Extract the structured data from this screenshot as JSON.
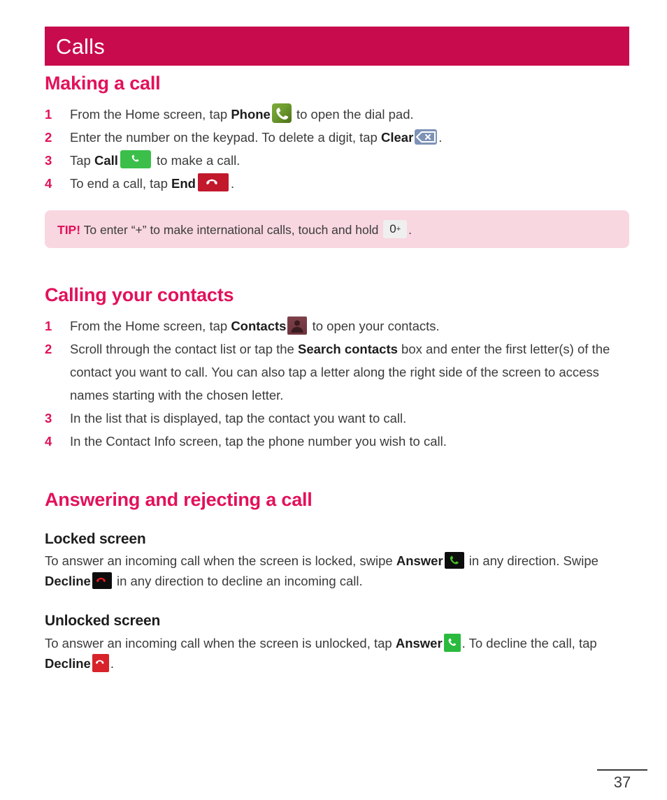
{
  "header": {
    "chapter_title": "Calls",
    "bar_color": "#c80b4c"
  },
  "colors": {
    "accent_pink": "#e2115a",
    "tip_background": "#f8d7e0",
    "body_text": "#3b3b3b"
  },
  "sections": [
    {
      "id": "making-a-call",
      "title": "Making a call",
      "steps": [
        {
          "num": "1",
          "pre": "From the Home screen, tap ",
          "bold": "Phone",
          "icon": "phone-home-icon",
          "post": " to open the dial pad."
        },
        {
          "num": "2",
          "pre": "Enter the number on the keypad. To delete a digit, tap ",
          "bold": "Clear",
          "icon": "clear-backspace-icon",
          "post": "."
        },
        {
          "num": "3",
          "pre": "Tap ",
          "bold": "Call",
          "icon": "call-button-icon",
          "post": " to make a call."
        },
        {
          "num": "4",
          "pre": "To end a call, tap ",
          "bold": "End",
          "icon": "end-call-icon",
          "post": "."
        }
      ],
      "tip": {
        "label": "TIP!",
        "pre": " To enter “+” to make international calls, touch and hold ",
        "key_digit": "0",
        "key_plus": "+",
        "post": "."
      }
    },
    {
      "id": "calling-your-contacts",
      "title": "Calling your contacts",
      "steps": [
        {
          "num": "1",
          "pre": "From the Home screen, tap ",
          "bold": "Contacts",
          "icon": "contacts-icon",
          "post": " to open your contacts."
        },
        {
          "num": "2",
          "pre": "Scroll through the contact list or tap the ",
          "bold": "Search contacts",
          "post": " box and enter the first letter(s) of the contact you want to call. You can also tap a letter along the right side of the screen to access names starting with the chosen letter."
        },
        {
          "num": "3",
          "pre": "In the list that is displayed, tap the contact you want to call."
        },
        {
          "num": "4",
          "pre": "In the Contact Info screen, tap the phone number you wish to call."
        }
      ]
    },
    {
      "id": "answering-and-rejecting",
      "title": "Answering and rejecting a call",
      "subsections": [
        {
          "id": "locked-screen",
          "title": "Locked screen",
          "pre": "To answer an incoming call when the screen is locked, swipe ",
          "bold1": "Answer",
          "icon1": "answer-locked-icon",
          "mid": " in any direction. Swipe ",
          "bold2": "Decline",
          "icon2": "decline-locked-icon",
          "post": " in any direction to decline an incoming call."
        },
        {
          "id": "unlocked-screen",
          "title": "Unlocked screen",
          "pre": "To answer an incoming call when the screen is unlocked, tap ",
          "bold1": "Answer",
          "icon1": "answer-unlocked-icon",
          "mid": ". To decline the call, tap ",
          "bold2": "Decline",
          "icon2": "decline-unlocked-icon",
          "post": "."
        }
      ]
    }
  ],
  "footer": {
    "page_number": "37"
  }
}
